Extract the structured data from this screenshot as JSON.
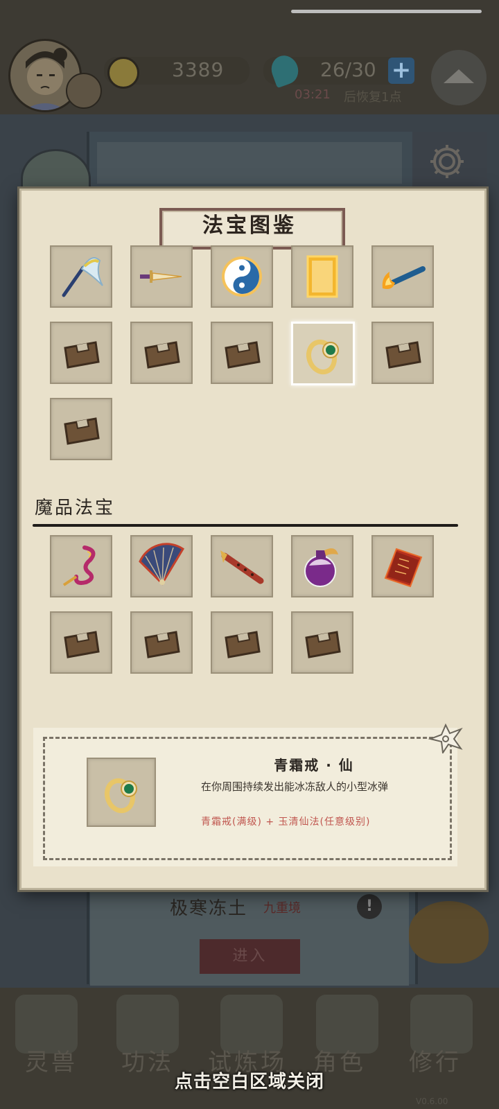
{
  "hud": {
    "coins": "3389",
    "stamina": "26/30",
    "plus_label": "+",
    "recover_timer": "03:21",
    "recover_text": "后恢复1点"
  },
  "zone": {
    "name": "极寒冻土",
    "level": "九重境",
    "info_label": "!",
    "enter_label": "进入"
  },
  "nav": {
    "items": [
      {
        "label": "灵兽"
      },
      {
        "label": "功法"
      },
      {
        "label": "试炼场"
      },
      {
        "label": "角色"
      },
      {
        "label": "修行"
      }
    ],
    "version": "V0.6.00"
  },
  "modal": {
    "title": "法宝图鉴",
    "section_label": "魔品法宝",
    "close_hint": "点击空白区域关闭"
  },
  "detail": {
    "name": "青霜戒 · 仙",
    "description": "在你周围持续发出能冰冻敌人的小型冰弹",
    "recipe": "青霜戒(满级) + 玉清仙法(任意级别)"
  },
  "icons": {
    "row1": [
      "whisk-icon",
      "dagger-icon",
      "yin-yang-icon",
      "golden-talisman-icon",
      "fire-brush-icon"
    ],
    "row2": [
      "locked-box-icon",
      "locked-box-icon",
      "locked-box-icon",
      "jade-ring-icon",
      "locked-box-icon"
    ],
    "row3": [
      "locked-box-icon"
    ],
    "demon_row1": [
      "jade-pendant-icon",
      "folding-fan-icon",
      "flute-icon",
      "potion-gourd-icon",
      "blood-talisman-icon"
    ],
    "demon_row2": [
      "locked-box-icon",
      "locked-box-icon",
      "locked-box-icon",
      "locked-box-icon"
    ]
  },
  "colors": {
    "paper": "#e9e1cb",
    "slot": "#c9bfa7",
    "title_border": "#7b5a52",
    "recipe_text": "#c0564f",
    "selected_border": "#ffffff"
  }
}
